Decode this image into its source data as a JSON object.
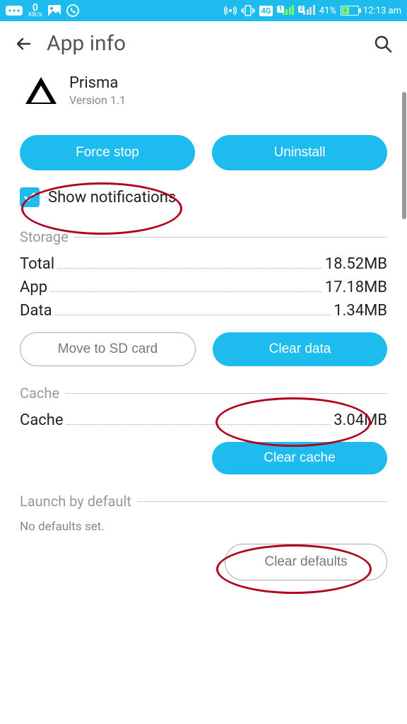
{
  "status": {
    "kbs_value": "0",
    "kbs_unit": "KB/s",
    "network_badge": "4G",
    "sim1": "1",
    "sim2": "2",
    "battery_pct": "41%",
    "time": "12:13 am"
  },
  "header": {
    "title": "App info"
  },
  "app": {
    "name": "Prisma",
    "version": "Version 1.1"
  },
  "actions": {
    "force_stop": "Force stop",
    "uninstall": "Uninstall",
    "show_notifications": "Show notifications"
  },
  "storage": {
    "title": "Storage",
    "total_label": "Total",
    "total_value": "18.52MB",
    "app_label": "App",
    "app_value": "17.18MB",
    "data_label": "Data",
    "data_value": "1.34MB",
    "move_sd": "Move to SD card",
    "clear_data": "Clear data"
  },
  "cache": {
    "title": "Cache",
    "cache_label": "Cache",
    "cache_value": "3.04MB",
    "clear_cache": "Clear cache"
  },
  "launch": {
    "title": "Launch by default",
    "none": "No defaults set.",
    "clear_defaults": "Clear defaults"
  }
}
